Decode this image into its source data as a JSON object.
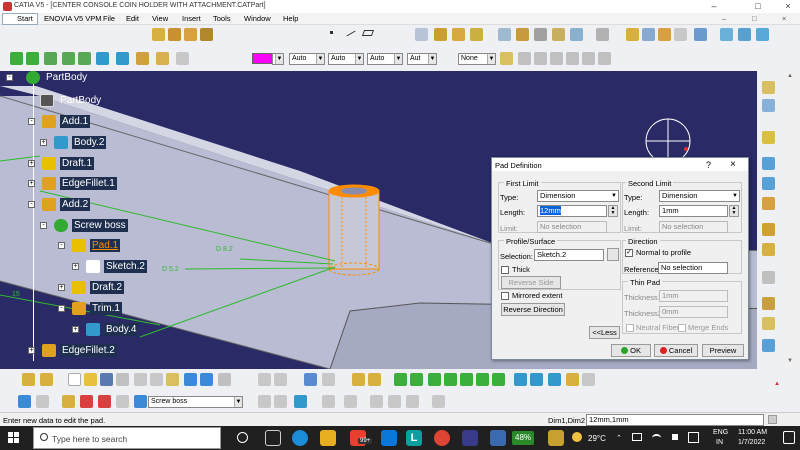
{
  "window": {
    "title": "CATIA V5 - [CENTER CONSOLE COIN HOLDER WITH ATTACHMENT.CATPart]",
    "controls": [
      "–",
      "□",
      "×"
    ],
    "doc_controls": [
      "–",
      "□",
      "×"
    ]
  },
  "menubar": {
    "items": [
      "Start",
      "ENOVIA V5 VPM",
      "File",
      "Edit",
      "View",
      "Insert",
      "Tools",
      "Window",
      "Help"
    ]
  },
  "graphic_props": {
    "color_swatch": "#ff00ff",
    "combos": [
      "Auto",
      "Auto",
      "Auto",
      "Aut",
      "None"
    ]
  },
  "tree": {
    "items": [
      {
        "label": "PartBody",
        "icon": "gear-icon",
        "icon_color": "#33aa33"
      },
      {
        "label": "PartBody",
        "icon": "part-body-icon",
        "icon_color": "#555555"
      },
      {
        "label": "Add.1",
        "icon": "add-icon",
        "icon_color": "#e0a020"
      },
      {
        "label": "Body.2",
        "icon": "body-icon",
        "icon_color": "#3399cc"
      },
      {
        "label": "Draft.1",
        "icon": "draft-icon",
        "icon_color": "#e8c000"
      },
      {
        "label": "EdgeFillet.1",
        "icon": "fillet-icon",
        "icon_color": "#e0a020"
      },
      {
        "label": "Add.2",
        "icon": "add-icon",
        "icon_color": "#e0a020"
      },
      {
        "label": "Screw boss",
        "icon": "gear-icon",
        "icon_color": "#33aa33"
      },
      {
        "label": "Pad.1",
        "icon": "pad-icon",
        "icon_color": "#e8c000"
      },
      {
        "label": "Sketch.2",
        "icon": "sketch-icon",
        "icon_color": "#ffffff"
      },
      {
        "label": "Draft.2",
        "icon": "draft-icon",
        "icon_color": "#e8c000"
      },
      {
        "label": "Trim.1",
        "icon": "trim-icon",
        "icon_color": "#e0a020"
      },
      {
        "label": "Body.4",
        "icon": "body-icon",
        "icon_color": "#3399cc"
      },
      {
        "label": "EdgeFillet.2",
        "icon": "fillet-icon",
        "icon_color": "#e0a020"
      }
    ]
  },
  "viewport": {
    "annotations": [
      "D 8.2",
      "D 5.2",
      "15"
    ],
    "accent_color": "#ff8c00",
    "background": "#2a2a66"
  },
  "dialog": {
    "title": "Pad Definition",
    "title_controls": [
      "?",
      "×"
    ],
    "first_limit": {
      "group": "First Limit",
      "type_label": "Type:",
      "type_value": "Dimension",
      "length_label": "Length:",
      "length_value": "12mm",
      "limit_label": "Limit:",
      "limit_value": "No selection"
    },
    "second_limit": {
      "group": "Second Limit",
      "type_label": "Type:",
      "type_value": "Dimension",
      "length_label": "Length:",
      "length_value": "1mm",
      "limit_label": "Limit:",
      "limit_value": "No selection"
    },
    "profile": {
      "group": "Profile/Surface",
      "selection_label": "Selection:",
      "selection_value": "Sketch.2",
      "thick_label": "Thick",
      "reverse_side": "Reverse Side"
    },
    "direction": {
      "group": "Direction",
      "normal_label": "Normal to profile",
      "reference_label": "Reference:",
      "reference_value": "No selection"
    },
    "thin_pad": {
      "group": "Thin Pad",
      "thickness1_label": "Thickness1:",
      "thickness1_value": "1mm",
      "thickness2_label": "Thickness2:",
      "thickness2_value": "0mm",
      "neutral_fiber": "Neutral Fiber",
      "merge_ends": "Merge Ends"
    },
    "mirrored_extent": "Mirrored extent",
    "reverse_direction": "Reverse Direction",
    "less_button": "<<Less",
    "ok": "OK",
    "cancel": "Cancel",
    "preview": "Preview"
  },
  "bottom_toolbar": {
    "body_combo": "Screw boss"
  },
  "statusbar": {
    "message": "Enter new data to edit the pad.",
    "prompt_label": "Dim1,Dim2",
    "prompt_value": "12mm,1mm"
  },
  "taskbar": {
    "search_placeholder": "Type here to search",
    "badge": "99+",
    "battery": "48%",
    "weather": "29°C",
    "lang1": "ENG",
    "lang2": "IN",
    "time": "11:00 AM",
    "date": "1/7/2022"
  }
}
